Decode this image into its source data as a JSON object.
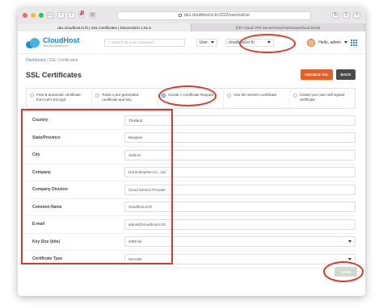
{
  "browser": {
    "url": "da1.cloudhost.in.th:2222/user/ssl/csr",
    "notif_count": "3",
    "tabs": [
      "da1.cloudhost.in.th | SSL Certificates | DirectAdmin 1.61.5",
      "[เช่า Cloud VPS Server/Cloud Windows/Cloud Email"
    ]
  },
  "header": {
    "brand": "CloudHost",
    "brand_sub": "www.cloudhost.in.th",
    "search_placeholder": "Search for your command",
    "user_select": "User",
    "domain_select": "cloudhost.in.th",
    "greeting": "Hello, admin"
  },
  "page": {
    "breadcrumb_link": "Dashboard",
    "breadcrumb_current": "/ SSL Certificates",
    "title": "SSL Certificates",
    "disable_button": "DISABLE SSL",
    "back_button": "BACK",
    "save_button": "SAVE"
  },
  "options": [
    {
      "label": "Free & automatic certificate from Let's Encrypt",
      "selected": false
    },
    {
      "label": "Paste a pre-generated certificate and key",
      "selected": false
    },
    {
      "label": "Create A Certificate Request",
      "selected": true
    },
    {
      "label": "Use the server's certificate",
      "selected": false
    },
    {
      "label": "Create your own self signed certificate",
      "selected": false
    }
  ],
  "form": [
    {
      "label": "Country",
      "value": "Thailand"
    },
    {
      "label": "State/Province",
      "value": "Bangkok"
    },
    {
      "label": "City",
      "value": "Sathorn"
    },
    {
      "label": "Company",
      "value": "Dot Enterprise Co., Ltd."
    },
    {
      "label": "Company Division",
      "value": "Cloud Service Provider"
    },
    {
      "label": "Common Name",
      "value": "cloudhost.in.th"
    },
    {
      "label": "E-mail",
      "value": "admin@cloudhost.in.th"
    },
    {
      "label": "Key Size (bits)",
      "value": "4096-bit"
    },
    {
      "label": "Certificate Type",
      "value": "SHA256"
    }
  ],
  "colors": {
    "accent": "#2a8fd7",
    "disable_button": "#e0622a",
    "annotation": "#d93a2b"
  }
}
